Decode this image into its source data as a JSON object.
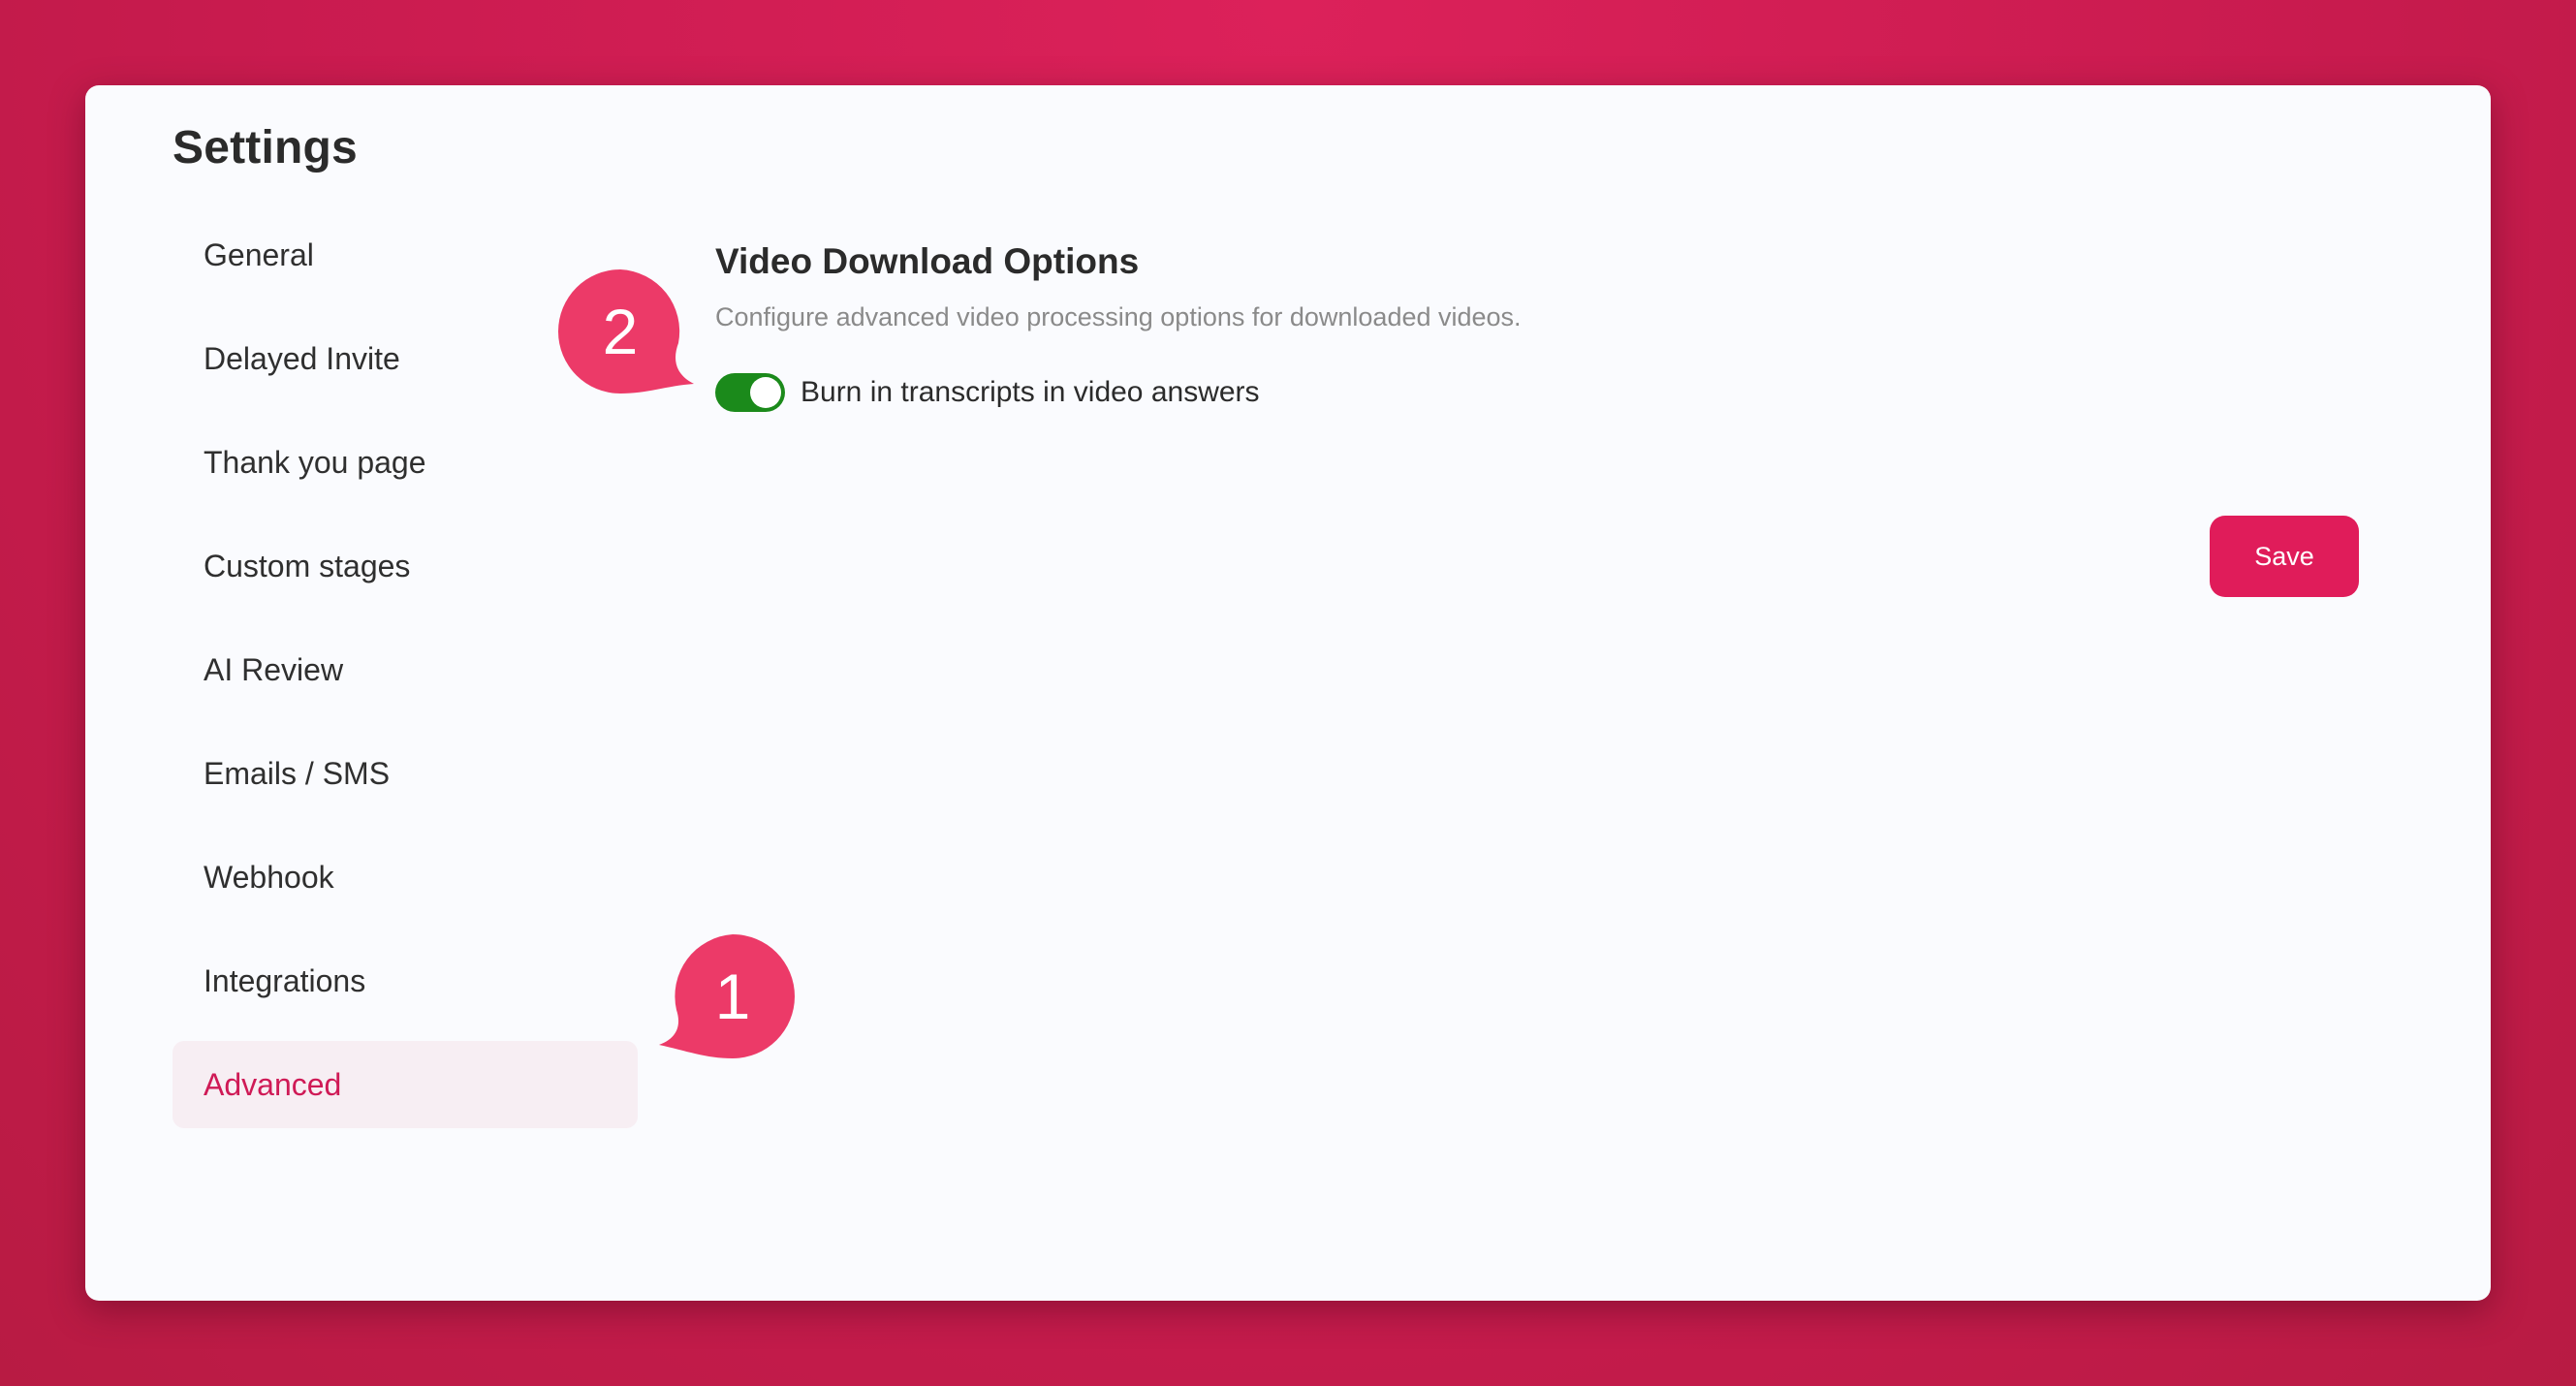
{
  "page": {
    "title": "Settings"
  },
  "sidebar": {
    "items": [
      {
        "label": "General",
        "active": false
      },
      {
        "label": "Delayed Invite",
        "active": false
      },
      {
        "label": "Thank you page",
        "active": false
      },
      {
        "label": "Custom stages",
        "active": false
      },
      {
        "label": "AI Review",
        "active": false
      },
      {
        "label": "Emails / SMS",
        "active": false
      },
      {
        "label": "Webhook",
        "active": false
      },
      {
        "label": "Integrations",
        "active": false
      },
      {
        "label": "Advanced",
        "active": true
      }
    ]
  },
  "section": {
    "title": "Video Download Options",
    "description": "Configure advanced video processing options for downloaded videos.",
    "toggle": {
      "label": "Burn in transcripts in video answers",
      "checked": true
    }
  },
  "actions": {
    "save_label": "Save"
  },
  "annotations": {
    "callout_1": "1",
    "callout_2": "2"
  },
  "colors": {
    "background": "#d01e55",
    "accent": "#e01c5a",
    "toggle_on": "#1b8a1b",
    "callout": "#ec3a68"
  }
}
